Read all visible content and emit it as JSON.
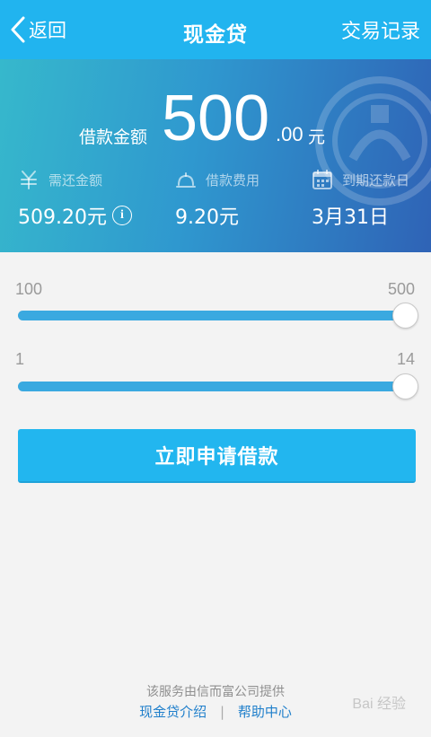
{
  "header": {
    "back_label": "返回",
    "title": "现金贷",
    "records_label": "交易记录"
  },
  "banner": {
    "amount_label": "借款金额",
    "amount_integer": "500",
    "amount_decimal": ".00",
    "amount_unit": "元",
    "repay": {
      "label": "需还金额",
      "value": "509.20元"
    },
    "fee": {
      "label": "借款费用",
      "value": "9.20元"
    },
    "due": {
      "label": "到期还款日",
      "value": "3月31日"
    }
  },
  "amount_slider": {
    "min_label": "100",
    "max_label": "500",
    "min": 100,
    "max": 500,
    "value": 500
  },
  "days_slider": {
    "min_label": "1",
    "max_label": "14",
    "min": 1,
    "max": 14,
    "value": 14
  },
  "apply_button_label": "立即申请借款",
  "footer": {
    "provider_text": "该服务由信而富公司提供",
    "links": [
      "现金贷介绍",
      "帮助中心"
    ],
    "separator": "|"
  },
  "watermark_text": "Bai 经验",
  "colors": {
    "header": "#21b4ef",
    "button": "#22b6ef",
    "slider_fill": "#3aa9e0",
    "link": "#1f7fcb"
  }
}
